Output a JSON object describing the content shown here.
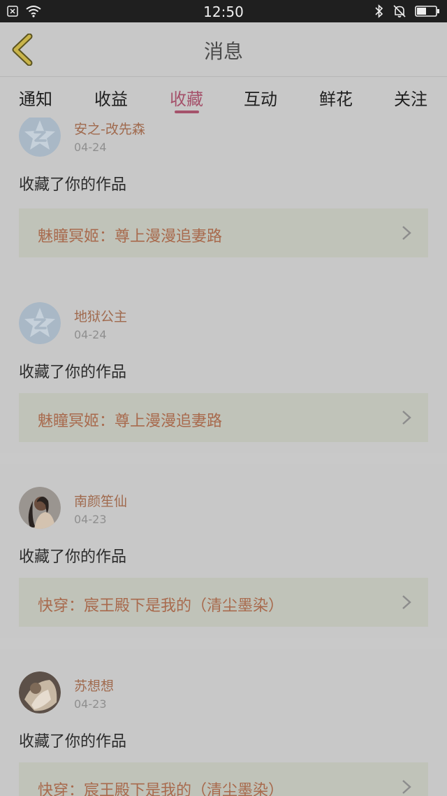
{
  "status": {
    "time": "12:50",
    "icons": [
      "close-box-icon",
      "wifi-icon",
      "bluetooth-icon",
      "bell-off-icon",
      "battery-icon"
    ]
  },
  "header": {
    "title": "消息",
    "back_icon": "chevron-left-icon",
    "accent": "#c9b44a"
  },
  "tabs": [
    {
      "label": "通知"
    },
    {
      "label": "收益"
    },
    {
      "label": "收藏",
      "active": true
    },
    {
      "label": "互动"
    },
    {
      "label": "鲜花"
    },
    {
      "label": "关注"
    }
  ],
  "colors": {
    "accent": "#a5526b",
    "username": "#a06a4e",
    "work_title": "#a86a4d"
  },
  "feed": [
    {
      "user": "安之-改先森",
      "date": "04-24",
      "action": "收藏了你的作品",
      "work": "魅瞳冥姬：尊上漫漫追妻路",
      "avatar": "default-star-avatar"
    },
    {
      "user": "地狱公主",
      "date": "04-24",
      "action": "收藏了你的作品",
      "work": "魅瞳冥姬：尊上漫漫追妻路",
      "avatar": "default-star-avatar"
    },
    {
      "user": "南颜笙仙",
      "date": "04-23",
      "action": "收藏了你的作品",
      "work": "快穿：宸王殿下是我的（清尘墨染）",
      "avatar": "photo-avatar"
    },
    {
      "user": "苏想想",
      "date": "04-23",
      "action": "收藏了你的作品",
      "work": "快穿：宸王殿下是我的（清尘墨染）",
      "avatar": "photo-avatar"
    }
  ]
}
